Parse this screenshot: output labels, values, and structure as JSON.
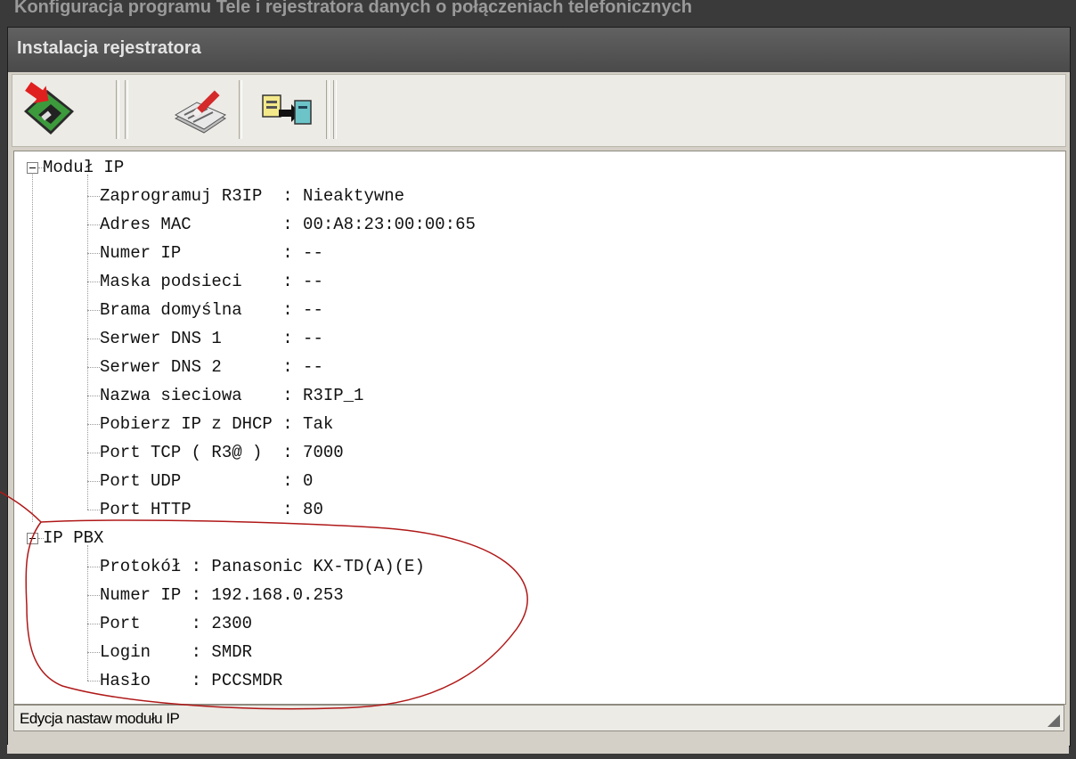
{
  "background_window_title": "Konfiguracja programu Tele i rejestratora danych o połączeniach telefonicznych",
  "window": {
    "title": "Instalacja rejestratora"
  },
  "toolbar": {
    "buttons": [
      {
        "icon": "install-disk-icon"
      },
      {
        "icon": "edit-settings-icon"
      },
      {
        "icon": "transfer-icon"
      }
    ]
  },
  "tree": {
    "groups": [
      {
        "label": "Moduł IP",
        "items": [
          "Zaprogramuj R3IP  : Nieaktywne",
          "Adres MAC         : 00:A8:23:00:00:65",
          "Numer IP          : --",
          "Maska podsieci    : --",
          "Brama domyślna    : --",
          "Serwer DNS 1      : --",
          "Serwer DNS 2      : --",
          "Nazwa sieciowa    : R3IP_1",
          "Pobierz IP z DHCP : Tak",
          "Port TCP ( R3@ )  : 7000",
          "Port UDP          : 0",
          "Port HTTP         : 80"
        ]
      },
      {
        "label": "IP PBX",
        "items": [
          "Protokół : Panasonic KX-TD(A)(E)",
          "Numer IP : 192.168.0.253",
          "Port     : 2300",
          "Login    : SMDR",
          "Hasło    : PCCSMDR"
        ]
      }
    ]
  },
  "status_bar": {
    "text": "Edycja nastaw modułu IP"
  },
  "colors": {
    "annotation": "#b01818"
  }
}
